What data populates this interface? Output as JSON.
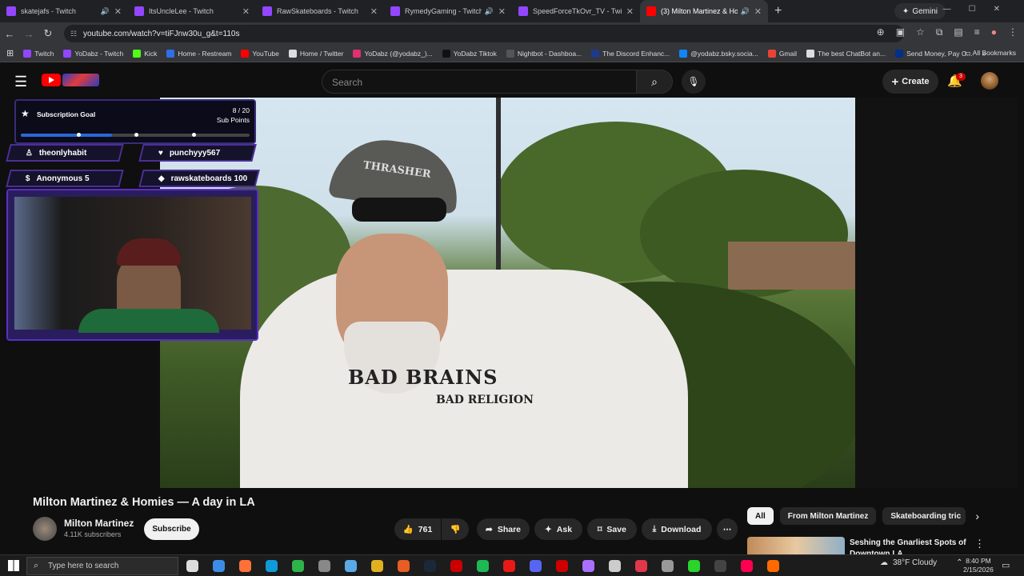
{
  "browser": {
    "tabs": [
      {
        "title": "skatejafs - Twitch",
        "color": "#9146ff",
        "audio": true
      },
      {
        "title": "ItsUncleLee - Twitch",
        "color": "#9146ff",
        "audio": false
      },
      {
        "title": "RawSkateboards - Twitch",
        "color": "#9146ff",
        "audio": false
      },
      {
        "title": "RymedyGaming - Twitch",
        "color": "#9146ff",
        "audio": true
      },
      {
        "title": "SpeedForceTkOvr_TV - Twitch",
        "color": "#9146ff",
        "audio": false
      },
      {
        "title": "(3) Milton Martinez & Hom",
        "color": "#ff0000",
        "audio": true,
        "active": true
      }
    ],
    "new_tab": "+",
    "gemini_label": "Gemini",
    "url": "youtube.com/watch?v=tiFJnw30u_g&t=110s",
    "bookmarks": [
      {
        "label": "Twitch",
        "color": "#9146ff"
      },
      {
        "label": "YoDabz - Twitch",
        "color": "#9146ff"
      },
      {
        "label": "Kick",
        "color": "#53fc18"
      },
      {
        "label": "Home - Restream",
        "color": "#2f6fe8"
      },
      {
        "label": "YouTube",
        "color": "#ff0000"
      },
      {
        "label": "Home / Twitter",
        "color": "#dddddd"
      },
      {
        "label": "YoDabz (@yodabz_)...",
        "color": "#e1306c"
      },
      {
        "label": "YoDabz Tiktok",
        "color": "#111111"
      },
      {
        "label": "Nightbot - Dashboa...",
        "color": "#555555"
      },
      {
        "label": "The Discord Enhanc...",
        "color": "#1e3a8a"
      },
      {
        "label": "@yodabz.bsky.socia...",
        "color": "#1185fe"
      },
      {
        "label": "Gmail",
        "color": "#ea4335"
      },
      {
        "label": "The best ChatBot an...",
        "color": "#dddddd"
      },
      {
        "label": "Send Money, Pay O...",
        "color": "#003087"
      }
    ],
    "all_bookmarks": "All Bookmarks"
  },
  "youtube": {
    "search_placeholder": "Search",
    "create_label": "Create",
    "notif_count": "3",
    "video_title": "Milton Martinez & Homies — A day in LA",
    "channel_name": "Milton Martinez",
    "subscribers": "4.11K subscribers",
    "subscribe_label": "Subscribe",
    "likes": "761",
    "share_label": "Share",
    "ask_label": "Ask",
    "save_label": "Save",
    "download_label": "Download",
    "chips": [
      "All",
      "From Milton Martinez",
      "Skateboarding tric"
    ],
    "rec_title": "Seshing the Gnarliest Spots of Downtown LA"
  },
  "overlay": {
    "goal_title": "Subscription Goal",
    "goal_count": "8 / 20",
    "goal_unit": "Sub Points",
    "goal_progress": 0.4,
    "events": [
      {
        "icon": "follow",
        "text": "theonlyhabit"
      },
      {
        "icon": "heart",
        "text": "punchyyy567"
      },
      {
        "icon": "dollar",
        "text": "Anonymous 5"
      },
      {
        "icon": "diamond",
        "text": "rawskateboards 100"
      }
    ]
  },
  "video_frame": {
    "shirt_text_1": "BAD BRAINS",
    "shirt_text_2": "BAD RELIGION",
    "cap_text": "THRASHER"
  },
  "taskbar": {
    "search_placeholder": "Type here to search",
    "weather": "38°F  Cloudy",
    "time": "8:40 PM",
    "date": "2/15/2026"
  }
}
